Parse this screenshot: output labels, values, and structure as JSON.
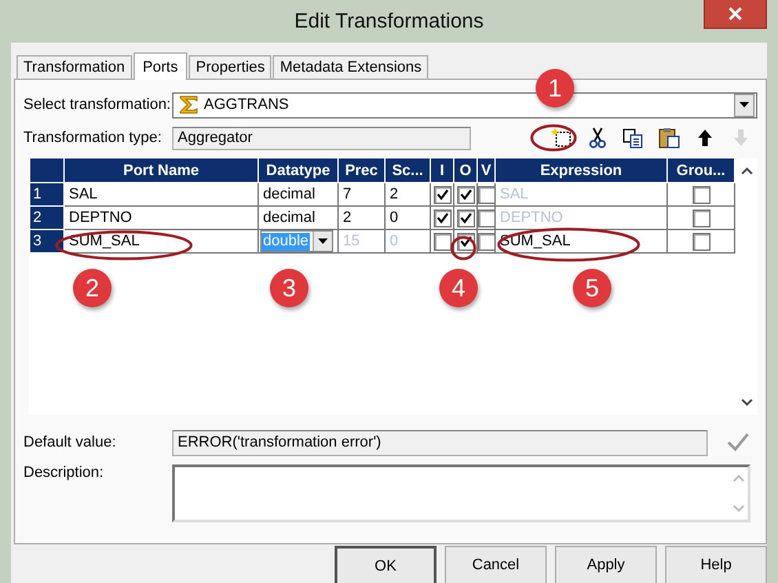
{
  "window": {
    "title": "Edit Transformations"
  },
  "tabs": [
    {
      "label": "Transformation",
      "selected": false
    },
    {
      "label": "Ports",
      "selected": true
    },
    {
      "label": "Properties",
      "selected": false
    },
    {
      "label": "Metadata Extensions",
      "selected": false
    }
  ],
  "select_transformation": {
    "label": "Select transformation:",
    "value": "AGGTRANS"
  },
  "transformation_type": {
    "label": "Transformation type:",
    "value": "Aggregator"
  },
  "toolbar": [
    {
      "kind": "new",
      "disabled": false
    },
    {
      "kind": "cut",
      "disabled": false
    },
    {
      "kind": "copy",
      "disabled": false
    },
    {
      "kind": "paste",
      "disabled": false
    },
    {
      "kind": "up",
      "disabled": false
    },
    {
      "kind": "down",
      "disabled": true
    }
  ],
  "grid": {
    "columns": [
      "Port Name",
      "Datatype",
      "Prec",
      "Sc...",
      "I",
      "O",
      "V",
      "Expression",
      "Grou..."
    ],
    "rows": [
      {
        "number": "1",
        "port_name": "SAL",
        "datatype": "decimal",
        "datatype_editing": false,
        "prec": "7",
        "scale": "2",
        "size_disabled": false,
        "input": true,
        "output": true,
        "variable": false,
        "expression": "SAL",
        "expression_disabled": true,
        "group_by": false
      },
      {
        "number": "2",
        "port_name": "DEPTNO",
        "datatype": "decimal",
        "datatype_editing": false,
        "prec": "2",
        "scale": "0",
        "size_disabled": false,
        "input": true,
        "output": true,
        "variable": false,
        "expression": "DEPTNO",
        "expression_disabled": true,
        "group_by": false
      },
      {
        "number": "3",
        "port_name": "SUM_SAL",
        "datatype": "double",
        "datatype_editing": true,
        "prec": "15",
        "scale": "0",
        "size_disabled": true,
        "input": false,
        "output": true,
        "variable": false,
        "expression": "SUM_SAL",
        "expression_disabled": false,
        "group_by": false
      }
    ]
  },
  "default_value": {
    "label": "Default value:",
    "value": "ERROR('transformation error')"
  },
  "description": {
    "label": "Description:"
  },
  "buttons": [
    "OK",
    "Cancel",
    "Apply",
    "Help"
  ],
  "annotations": [
    "1",
    "2",
    "3",
    "4",
    "5"
  ]
}
